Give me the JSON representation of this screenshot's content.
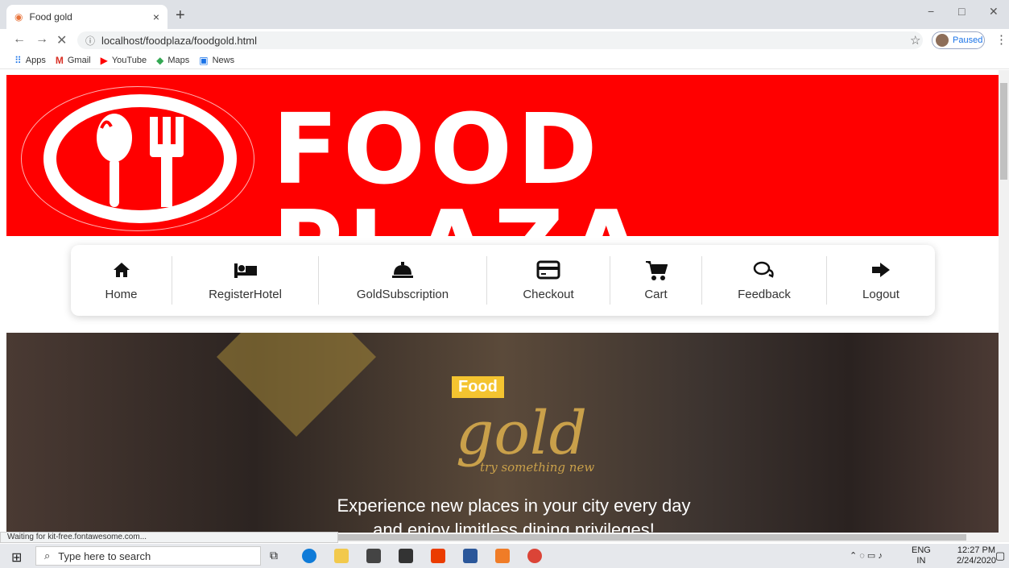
{
  "browser": {
    "tab_title": "Food gold",
    "tab_close": "×",
    "new_tab": "+",
    "url": "localhost/foodplaza/foodgold.html",
    "profile_status": "Paused",
    "window_controls": {
      "minimize": "−",
      "maximize": "□",
      "close": "✕"
    },
    "nav": {
      "back": "←",
      "forward": "→",
      "stop": "✕"
    },
    "bookmarks": [
      {
        "label": "Apps",
        "icon": "apps-icon"
      },
      {
        "label": "Gmail",
        "icon": "gmail-icon"
      },
      {
        "label": "YouTube",
        "icon": "youtube-icon"
      },
      {
        "label": "Maps",
        "icon": "maps-icon"
      },
      {
        "label": "News",
        "icon": "news-icon"
      }
    ],
    "status_text": "Waiting for kit-free.fontawesome.com..."
  },
  "banner": {
    "brand": "FOOD PLAZA",
    "background_color": "#ff0000"
  },
  "nav": {
    "items": [
      {
        "label": "Home",
        "icon": "home-icon"
      },
      {
        "label": "RegisterHotel",
        "icon": "bed-icon"
      },
      {
        "label": "GoldSubscription",
        "icon": "concierge-bell-icon"
      },
      {
        "label": "Checkout",
        "icon": "credit-card-icon"
      },
      {
        "label": "Cart",
        "icon": "cart-icon"
      },
      {
        "label": "Feedback",
        "icon": "comments-icon"
      },
      {
        "label": "Logout",
        "icon": "sign-out-icon"
      }
    ]
  },
  "hero": {
    "tag": "Food",
    "logo": "gold",
    "tagline": "try something new",
    "line1": "Experience new places in your city every day",
    "line2": "and enjoy limitless dining privileges!",
    "accent_color": "#c9a04a"
  },
  "taskbar": {
    "search_placeholder": "Type here to search",
    "lang_top": "ENG",
    "lang_bottom": "IN",
    "time": "12:27 PM",
    "date": "2/24/2020"
  }
}
